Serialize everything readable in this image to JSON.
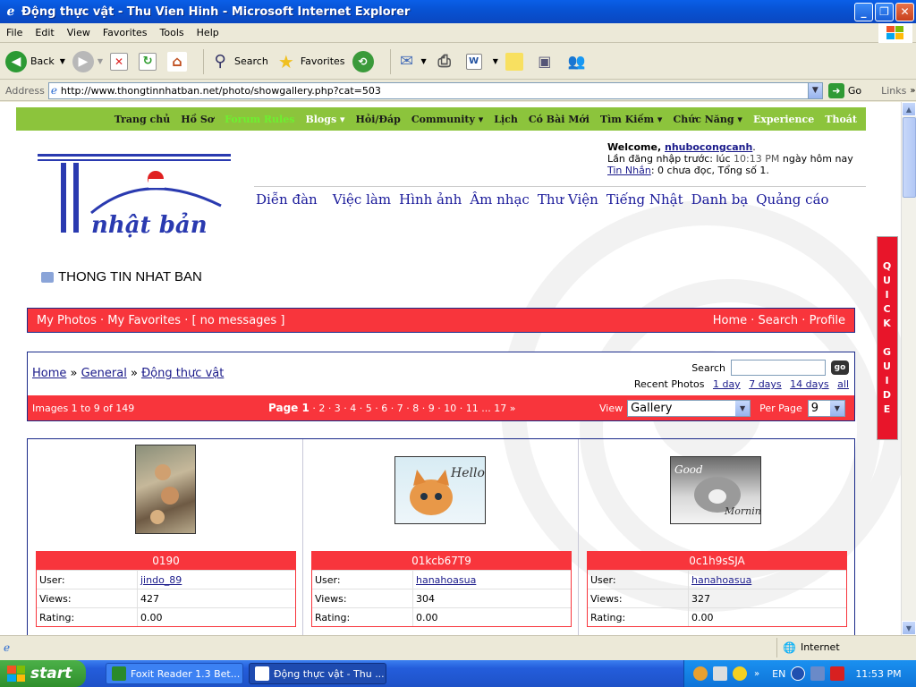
{
  "window": {
    "title": "Động thực vật - Thu Vien Hinh - Microsoft Internet Explorer",
    "minimize": "_",
    "maximize": "❐",
    "close": "✕"
  },
  "menu": [
    "File",
    "Edit",
    "View",
    "Favorites",
    "Tools",
    "Help"
  ],
  "toolbar": {
    "back": "Back",
    "search": "Search",
    "favorites": "Favorites"
  },
  "address": {
    "label": "Address",
    "url": "http://www.thongtinnhatban.net/photo/showgallery.php?cat=503",
    "go": "Go",
    "links": "Links"
  },
  "topnav": [
    {
      "label": "Trang chủ",
      "style": "dark"
    },
    {
      "label": "Hồ Sơ",
      "style": "dark"
    },
    {
      "label": "Forum Rules",
      "style": "hl"
    },
    {
      "label": "Blogs ▾",
      "style": "white"
    },
    {
      "label": "Hỏi/Đáp",
      "style": "dark"
    },
    {
      "label": "Community ▾",
      "style": "dark"
    },
    {
      "label": "Lịch",
      "style": "dark"
    },
    {
      "label": "Có Bài Mới",
      "style": "dark"
    },
    {
      "label": "Tìm Kiếm ▾",
      "style": "dark"
    },
    {
      "label": "Chức Năng ▾",
      "style": "dark"
    },
    {
      "label": "Experience",
      "style": "white"
    },
    {
      "label": "Thoát",
      "style": "white"
    }
  ],
  "welcome": {
    "prefix": "Welcome, ",
    "user": "nhubocongcanh",
    "last_visit_label": "Lần đăng nhập trước: lúc ",
    "last_visit_time": "10:13 PM",
    "last_visit_suffix": " ngày hôm nay",
    "pm_link": "Tin Nhắn",
    "pm_text": ": 0 chưa đọc, Tổng số 1."
  },
  "mainnav": [
    "Diễn đàn",
    "Việc làm",
    "Hình ảnh",
    "Âm nhạc",
    "Thư Viện",
    "Tiếng Nhật",
    "Danh bạ",
    "Quảng cáo"
  ],
  "sitename": "THONG TIN NHAT BAN",
  "userbar": {
    "left": "My Photos · My Favorites · [ no messages ]",
    "right": "Home · Search · Profile"
  },
  "breadcrumb": {
    "home": "Home",
    "sep": " » ",
    "general": "General",
    "current": "Động thực vật"
  },
  "search": {
    "label": "Search",
    "go": "go",
    "recent_label": "Recent Photos",
    "recent": [
      "1 day",
      "7 days",
      "14 days",
      "all"
    ]
  },
  "pager": {
    "info": "Images 1 to 9 of 149",
    "current": "Page 1",
    "pages": "· 2 · 3 · 4 · 5 · 6 · 7 · 8 · 9 · 10 · 11 ... 17 »",
    "view_label": "View",
    "view_value": "Gallery",
    "perpage_label": "Per Page",
    "perpage_value": "9"
  },
  "photos": [
    {
      "title": "0190",
      "user": "jindo_89",
      "views": "427",
      "rating": "0.00"
    },
    {
      "title": "01kcb67T9",
      "user": "hanahoasua",
      "views": "304",
      "rating": "0.00"
    },
    {
      "title": "0c1h9sSJA",
      "user": "hanahoasua",
      "views": "327",
      "rating": "0.00"
    }
  ],
  "photo_labels": {
    "user": "User:",
    "views": "Views:",
    "rating": "Rating:"
  },
  "quickguide": [
    "Q",
    "U",
    "I",
    "C",
    "K",
    " ",
    "G",
    "U",
    "I",
    "D",
    "E"
  ],
  "status": {
    "zone": "Internet"
  },
  "taskbar": {
    "start": "start",
    "tasks": [
      "Foxit Reader 1.3 Bet...",
      "Động thực vật - Thu ..."
    ],
    "lang": "EN",
    "clock": "11:53 PM"
  }
}
